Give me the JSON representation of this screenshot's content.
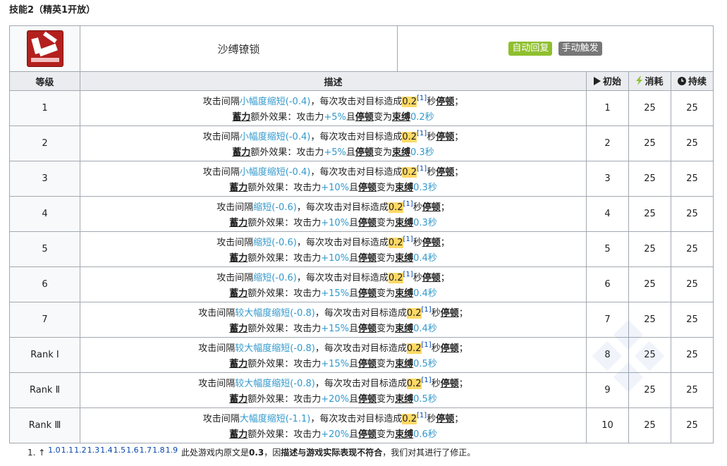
{
  "heading": "技能2（精英1开放）",
  "skill": {
    "name": "沙缚镣锁",
    "icon": "skill-chain-icon",
    "badges": [
      {
        "label": "自动回复",
        "color": "#8fbf2e"
      },
      {
        "label": "手动触发",
        "color": "#777777"
      }
    ]
  },
  "columns": {
    "level": "等级",
    "description": "描述",
    "initial": "初始",
    "cost": "消耗",
    "duration": "持续"
  },
  "rows": [
    {
      "level": "1",
      "interval_label": "小幅度缩短",
      "interval_val": "(-0.4)",
      "atk": "+5%",
      "bind": "0.2秒",
      "initial": "1",
      "cost": "25",
      "duration": "25"
    },
    {
      "level": "2",
      "interval_label": "小幅度缩短",
      "interval_val": "(-0.4)",
      "atk": "+5%",
      "bind": "0.3秒",
      "initial": "2",
      "cost": "25",
      "duration": "25"
    },
    {
      "level": "3",
      "interval_label": "小幅度缩短",
      "interval_val": "(-0.4)",
      "atk": "+10%",
      "bind": "0.3秒",
      "initial": "3",
      "cost": "25",
      "duration": "25"
    },
    {
      "level": "4",
      "interval_label": "缩短",
      "interval_val": "(-0.6)",
      "atk": "+10%",
      "bind": "0.3秒",
      "initial": "4",
      "cost": "25",
      "duration": "25"
    },
    {
      "level": "5",
      "interval_label": "缩短",
      "interval_val": "(-0.6)",
      "atk": "+10%",
      "bind": "0.4秒",
      "initial": "5",
      "cost": "25",
      "duration": "25"
    },
    {
      "level": "6",
      "interval_label": "缩短",
      "interval_val": "(-0.6)",
      "atk": "+15%",
      "bind": "0.4秒",
      "initial": "6",
      "cost": "25",
      "duration": "25"
    },
    {
      "level": "7",
      "interval_label": "较大幅度缩短",
      "interval_val": "(-0.8)",
      "atk": "+15%",
      "bind": "0.4秒",
      "initial": "7",
      "cost": "25",
      "duration": "25"
    },
    {
      "level": "Rank Ⅰ",
      "interval_label": "较大幅度缩短",
      "interval_val": "(-0.8)",
      "atk": "+15%",
      "bind": "0.5秒",
      "initial": "8",
      "cost": "25",
      "duration": "25"
    },
    {
      "level": "Rank Ⅱ",
      "interval_label": "较大幅度缩短",
      "interval_val": "(-0.8)",
      "atk": "+20%",
      "bind": "0.5秒",
      "initial": "9",
      "cost": "25",
      "duration": "25"
    },
    {
      "level": "Rank Ⅲ",
      "interval_label": "大幅度缩短",
      "interval_val": "(-1.1)",
      "atk": "+20%",
      "bind": "0.6秒",
      "initial": "10",
      "cost": "25",
      "duration": "25"
    }
  ],
  "desc_text": {
    "prefix": "攻击间隔",
    "mid": "，每次攻击对目标造成",
    "stun_sec": "0.2",
    "ref": "[1]",
    "sec": "秒",
    "stun": "停顿",
    "end": "；",
    "charge": "蓄力",
    "extra": "额外效果：攻击力",
    "and": "且",
    "stun2": "停顿",
    "becomes": "变为",
    "bind_word": "束缚"
  },
  "footnote": {
    "num": "1. ↑",
    "refs": [
      "1.0",
      "1.1",
      "1.2",
      "1.3",
      "1.4",
      "1.5",
      "1.6",
      "1.7",
      "1.8",
      "1.9"
    ],
    "text_a": "此处游戏内原文是",
    "orig_val": "0.3",
    "text_b": "，因",
    "text_c": "描述与游戏实际表现不符合",
    "text_d": "，我们对其进行了修正。"
  },
  "colors": {
    "highlight": "#3399cc",
    "stun_bg": "#ffd966",
    "header_bg": "#eaecf0"
  }
}
